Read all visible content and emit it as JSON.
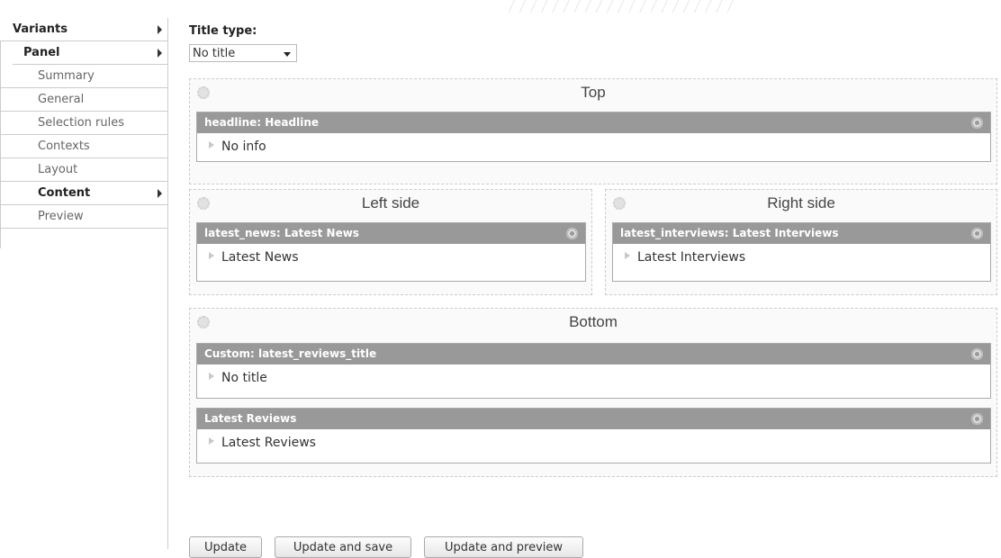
{
  "nav": {
    "items": [
      {
        "label": "Variants"
      },
      {
        "label": "Panel"
      },
      {
        "label": "Summary"
      },
      {
        "label": "General"
      },
      {
        "label": "Selection rules"
      },
      {
        "label": "Contexts"
      },
      {
        "label": "Layout"
      },
      {
        "label": "Content"
      },
      {
        "label": "Preview"
      }
    ]
  },
  "title_type": {
    "label": "Title type:",
    "selected": "No title"
  },
  "regions": {
    "top": {
      "title": "Top",
      "panes": [
        {
          "header": "headline: Headline",
          "body": "No info"
        }
      ]
    },
    "left": {
      "title": "Left side",
      "panes": [
        {
          "header": "latest_news: Latest News",
          "body": "Latest News"
        }
      ]
    },
    "right": {
      "title": "Right side",
      "panes": [
        {
          "header": "latest_interviews: Latest Interviews",
          "body": "Latest Interviews"
        }
      ]
    },
    "bottom": {
      "title": "Bottom",
      "panes": [
        {
          "header": "Custom: latest_reviews_title",
          "body": "No title"
        },
        {
          "header": "Latest Reviews",
          "body": "Latest Reviews"
        }
      ]
    }
  },
  "buttons": {
    "update": "Update",
    "update_save": "Update and save",
    "update_preview": "Update and preview"
  }
}
